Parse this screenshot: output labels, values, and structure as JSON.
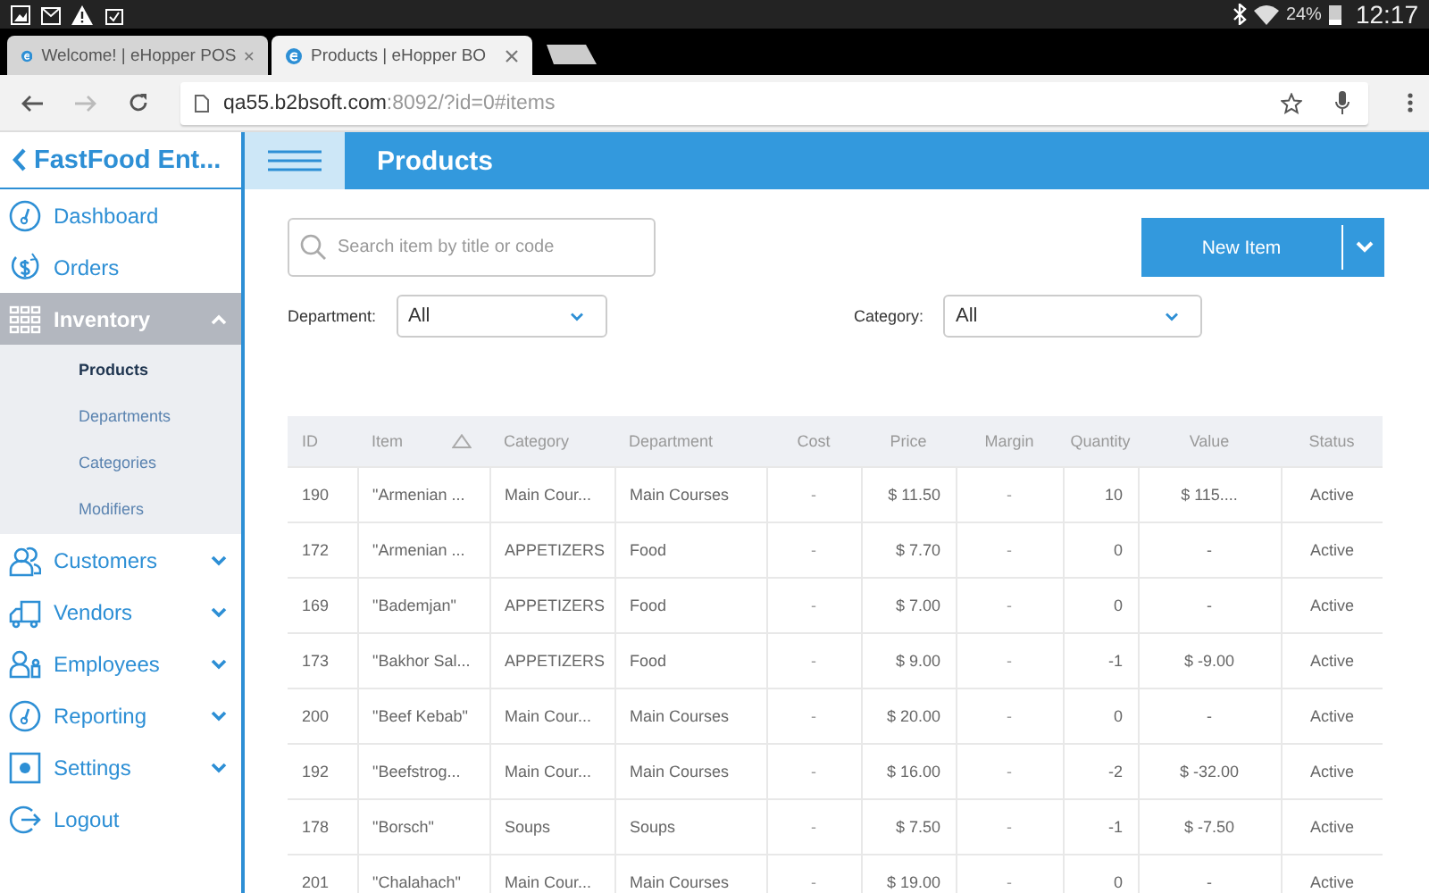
{
  "status_bar": {
    "battery": "24%",
    "time": "12:17"
  },
  "browser_tabs": [
    {
      "title": "Welcome! | eHopper POS",
      "selected": false
    },
    {
      "title": "Products | eHopper BO",
      "selected": true
    }
  ],
  "address_bar": {
    "host": "qa55.b2bsoft.com",
    "path": ":8092/?id=0#items"
  },
  "app_header": {
    "back_title": "FastFood Ent...",
    "title": "Products"
  },
  "sidebar": {
    "items": [
      {
        "label": "Dashboard",
        "kind": "link",
        "selected": false
      },
      {
        "label": "Orders",
        "kind": "link",
        "selected": false
      },
      {
        "label": "Inventory",
        "kind": "group",
        "selected": true,
        "expanded": true,
        "children": [
          {
            "label": "Products",
            "selected": true
          },
          {
            "label": "Departments",
            "selected": false
          },
          {
            "label": "Categories",
            "selected": false
          },
          {
            "label": "Modifiers",
            "selected": false
          }
        ]
      },
      {
        "label": "Customers",
        "kind": "group",
        "selected": false,
        "expanded": false
      },
      {
        "label": "Vendors",
        "kind": "group",
        "selected": false,
        "expanded": false
      },
      {
        "label": "Employees",
        "kind": "group",
        "selected": false,
        "expanded": false
      },
      {
        "label": "Reporting",
        "kind": "group",
        "selected": false,
        "expanded": false
      },
      {
        "label": "Settings",
        "kind": "group",
        "selected": false,
        "expanded": false
      },
      {
        "label": "Logout",
        "kind": "link",
        "selected": false
      }
    ]
  },
  "toolbar": {
    "search": {
      "placeholder": "Search item by title or code"
    },
    "new_button": "New Item"
  },
  "filters": [
    {
      "label": "Department:",
      "value": "All"
    },
    {
      "label": "Category:",
      "value": "All"
    }
  ],
  "table": {
    "columns": [
      {
        "label": "ID",
        "sorted": false
      },
      {
        "label": "Item",
        "sorted": true
      },
      {
        "label": "Category",
        "sorted": false
      },
      {
        "label": "Department",
        "sorted": false
      },
      {
        "label": "Cost",
        "sorted": false
      },
      {
        "label": "Price",
        "sorted": false
      },
      {
        "label": "Margin",
        "sorted": false
      },
      {
        "label": "Quantity",
        "sorted": false
      },
      {
        "label": "Value",
        "sorted": false
      },
      {
        "label": "Status",
        "sorted": false
      }
    ],
    "rows": [
      [
        "190",
        "\"Armenian ...",
        "Main Cour...",
        "Main Courses",
        "-",
        "$ 11.50",
        "-",
        "10",
        "$ 115....",
        "Active"
      ],
      [
        "172",
        "\"Armenian ...",
        "APPETIZERS",
        "Food",
        "-",
        "$ 7.70",
        "-",
        "0",
        "-",
        "Active"
      ],
      [
        "169",
        "\"Bademjan\"",
        "APPETIZERS",
        "Food",
        "-",
        "$ 7.00",
        "-",
        "0",
        "-",
        "Active"
      ],
      [
        "173",
        "\"Bakhor Sal...",
        "APPETIZERS",
        "Food",
        "-",
        "$ 9.00",
        "-",
        "-1",
        "$ -9.00",
        "Active"
      ],
      [
        "200",
        "\"Beef Kebab\"",
        "Main Cour...",
        "Main Courses",
        "-",
        "$ 20.00",
        "-",
        "0",
        "-",
        "Active"
      ],
      [
        "192",
        "\"Beefstrog...",
        "Main Cour...",
        "Main Courses",
        "-",
        "$ 16.00",
        "-",
        "-2",
        "$ -32.00",
        "Active"
      ],
      [
        "178",
        "\"Borsch\"",
        "Soups",
        "Soups",
        "-",
        "$ 7.50",
        "-",
        "-1",
        "$ -7.50",
        "Active"
      ],
      [
        "201",
        "\"Chalahach\"",
        "Main Cour...",
        "Main Courses",
        "-",
        "$ 19.00",
        "-",
        "0",
        "-",
        "Active"
      ]
    ]
  }
}
